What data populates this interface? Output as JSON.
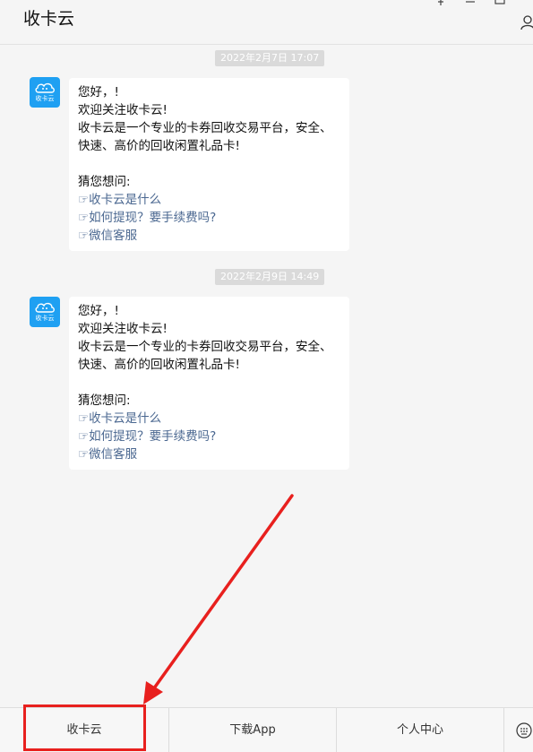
{
  "window": {
    "title": "收卡云"
  },
  "messages": [
    {
      "timestamp": "2022年2月7日  17:07",
      "sender": "收卡云",
      "greeting": "您好，!",
      "welcome": "欢迎关注收卡云!",
      "description": "收卡云是一个专业的卡券回收交易平台，安全、快速、高价的回收闲置礼品卡!",
      "guess_title": "猜您想问:",
      "links": [
        "☞收卡云是什么",
        "☞如何提现？要手续费吗?",
        "☞微信客服"
      ]
    },
    {
      "timestamp": "2022年2月9日  14:49",
      "sender": "收卡云",
      "greeting": "您好，!",
      "welcome": "欢迎关注收卡云!",
      "description": "收卡云是一个专业的卡券回收交易平台，安全、快速、高价的回收闲置礼品卡!",
      "guess_title": "猜您想问:",
      "links": [
        "☞收卡云是什么",
        "☞如何提现？要手续费吗?",
        "☞微信客服"
      ]
    }
  ],
  "bottom_menu": [
    "收卡云",
    "下载App",
    "个人中心"
  ],
  "icons": {
    "pin": "pin-icon",
    "minimize": "minimize-icon",
    "maximize": "maximize-icon",
    "profile": "profile-icon",
    "keyboard": "keyboard-icon"
  },
  "colors": {
    "link": "#4a6790",
    "annotation": "#e8201e",
    "avatar": "#1fa0f2"
  }
}
